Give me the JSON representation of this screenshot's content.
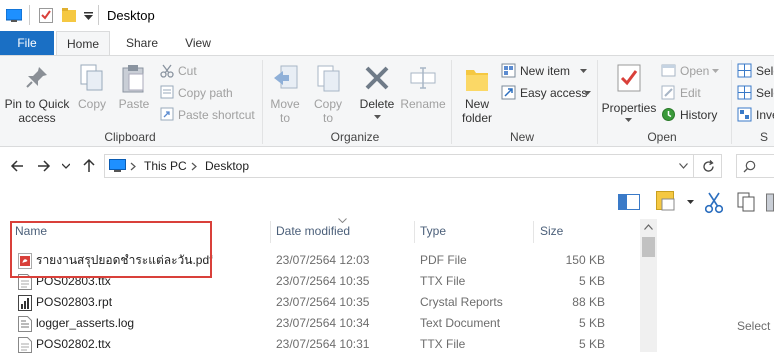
{
  "window": {
    "title": "Desktop"
  },
  "tabs": [
    {
      "label": "File"
    },
    {
      "label": "Home"
    },
    {
      "label": "Share"
    },
    {
      "label": "View"
    }
  ],
  "ribbon": {
    "clipboard": {
      "label": "Clipboard",
      "pin": "Pin to Quick access",
      "pin_l1": "Pin to Quick",
      "pin_l2": "access",
      "copy": "Copy",
      "paste": "Paste",
      "cut": "Cut",
      "copy_path": "Copy path",
      "paste_shortcut": "Paste shortcut"
    },
    "organize": {
      "label": "Organize",
      "move_to": "Move",
      "move_to2": "to",
      "copy_to": "Copy",
      "copy_to2": "to",
      "delete": "Delete",
      "rename": "Rename"
    },
    "new": {
      "label": "New",
      "new_folder1": "New",
      "new_folder2": "folder",
      "new_item": "New item",
      "easy_access": "Easy access"
    },
    "open": {
      "label": "Open",
      "properties": "Properties",
      "open": "Open",
      "edit": "Edit",
      "history": "History"
    },
    "select": {
      "label": "S",
      "select_all": "Sele",
      "select_none": "Sele",
      "invert": "Inve"
    }
  },
  "address": {
    "crumbs": [
      "This PC",
      "Desktop"
    ]
  },
  "columns": {
    "name": "Name",
    "date": "Date modified",
    "type": "Type",
    "size": "Size"
  },
  "files": [
    {
      "name": "รายงานสรุปยอดชำระแต่ละวัน.pdf",
      "date": "23/07/2564 12:03",
      "type": "PDF File",
      "size": "150 KB",
      "icon": "pdf-icon"
    },
    {
      "name": "POS02803.ttx",
      "date": "23/07/2564 10:35",
      "type": "TTX File",
      "size": "5 KB",
      "icon": "ttx-icon"
    },
    {
      "name": "POS02803.rpt",
      "date": "23/07/2564 10:35",
      "type": "Crystal Reports",
      "size": "88 KB",
      "icon": "rpt-icon"
    },
    {
      "name": "logger_asserts.log",
      "date": "23/07/2564 10:34",
      "type": "Text Document",
      "size": "5 KB",
      "icon": "log-icon"
    },
    {
      "name": "POS02802.ttx",
      "date": "23/07/2564 10:31",
      "type": "TTX File",
      "size": "5 KB",
      "icon": "ttx-icon"
    }
  ],
  "preview": {
    "text": "Select a"
  },
  "colors": {
    "accent": "#1a6fc4",
    "highlight": "#d9403a"
  }
}
